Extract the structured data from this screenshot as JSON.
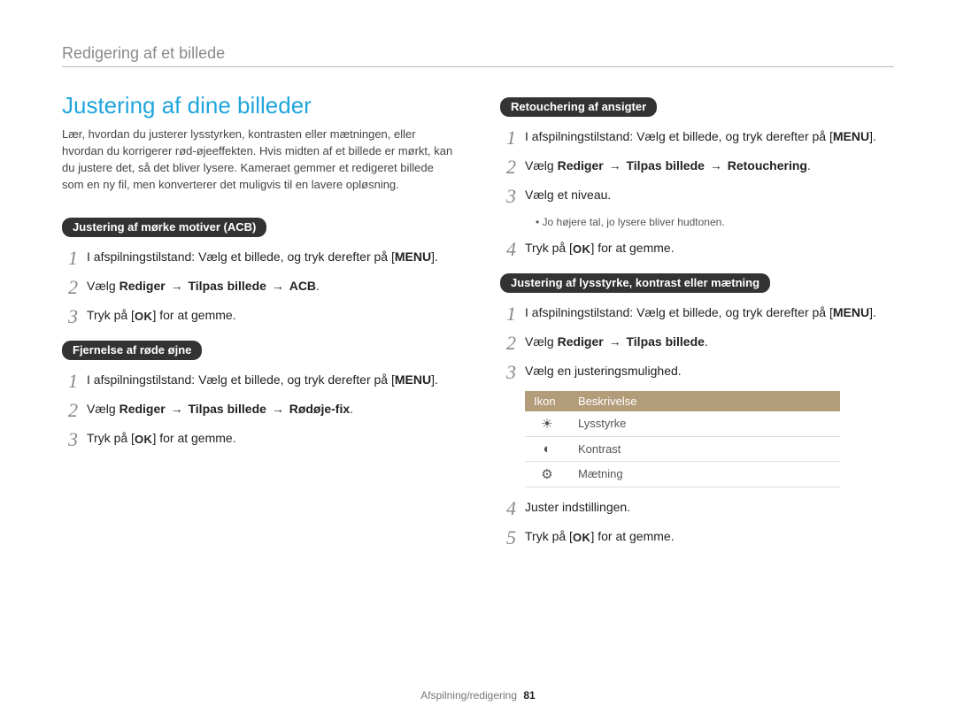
{
  "header": "Redigering af et billede",
  "left": {
    "title": "Justering af dine billeder",
    "intro": "Lær, hvordan du justerer lysstyrken, kontrasten eller mætningen, eller hvordan du korrigerer rød-øjeeffekten. Hvis midten af et billede er mørkt, kan du justere det, så det bliver lysere. Kameraet gemmer et redigeret billede som en ny fil, men konverterer det muligvis til en lavere opløsning.",
    "sec1": {
      "label": "Justering af mørke motiver (ACB)",
      "s1_pre": "I afspilningstilstand: Vælg et billede, og tryk derefter på [",
      "menu": "MENU",
      "s1_post": "].",
      "s2_pre": "Vælg ",
      "path_a": "Rediger",
      "path_b": "Tilpas billede",
      "path_c": "ACB",
      "s3_pre": "Tryk på [",
      "ok": "OK",
      "s3_post": "] for at gemme."
    },
    "sec2": {
      "label": "Fjernelse af røde øjne",
      "s1_pre": "I afspilningstilstand: Vælg et billede, og tryk derefter på [",
      "menu": "MENU",
      "s1_post": "].",
      "s2_pre": "Vælg ",
      "path_a": "Rediger",
      "path_b": "Tilpas billede",
      "path_c": "Rødøje-fix",
      "s3_pre": "Tryk på [",
      "ok": "OK",
      "s3_post": "] for at gemme."
    }
  },
  "right": {
    "sec1": {
      "label": "Retouchering af ansigter",
      "s1_pre": "I afspilningstilstand: Vælg et billede, og tryk derefter på [",
      "menu": "MENU",
      "s1_post": "].",
      "s2_pre": "Vælg ",
      "path_a": "Rediger",
      "path_b": "Tilpas billede",
      "path_c": "Retouchering",
      "s3": "Vælg et niveau.",
      "note": "Jo højere tal, jo lysere bliver hudtonen.",
      "s4_pre": "Tryk på [",
      "ok": "OK",
      "s4_post": "] for at gemme."
    },
    "sec2": {
      "label": "Justering af lysstyrke, kontrast eller mætning",
      "s1_pre": "I afspilningstilstand: Vælg et billede, og tryk derefter på [",
      "menu": "MENU",
      "s1_post": "].",
      "s2_pre": "Vælg ",
      "path_a": "Rediger",
      "path_b": "Tilpas billede",
      "s3": "Vælg en justeringsmulighed.",
      "table": {
        "h1": "Ikon",
        "h2": "Beskrivelse",
        "r1": "Lysstyrke",
        "r2": "Kontrast",
        "r3": "Mætning",
        "i1": "☀",
        "i2": "◐",
        "i3": "⚙"
      },
      "s4": "Juster indstillingen.",
      "s5_pre": "Tryk på [",
      "ok": "OK",
      "s5_post": "] for at gemme."
    }
  },
  "arrow": "→",
  "footer": {
    "text": "Afspilning/redigering",
    "page": "81"
  }
}
